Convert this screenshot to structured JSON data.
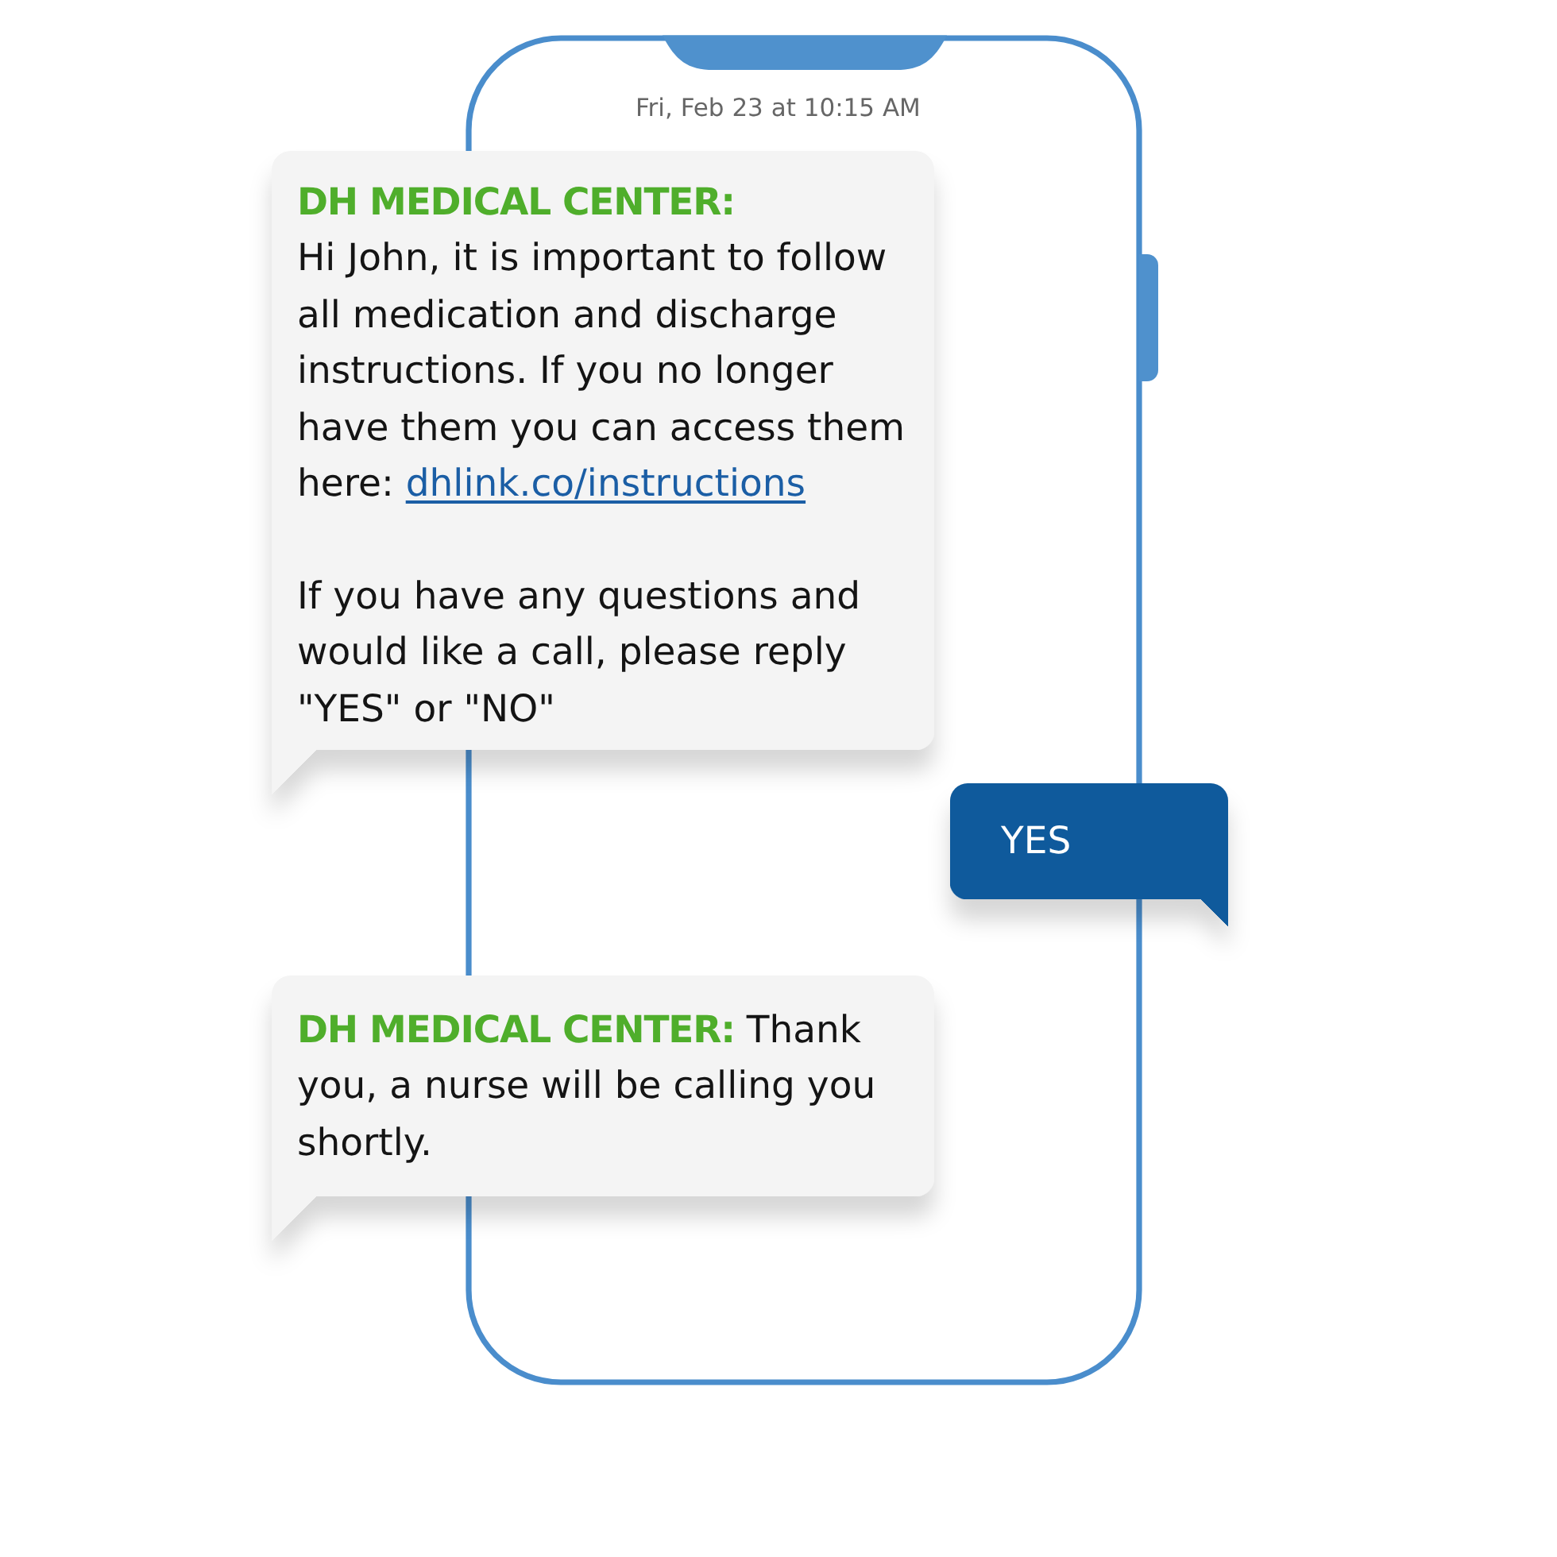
{
  "timestamp": "Fri, Feb 23 at 10:15 AM",
  "messages": [
    {
      "kind": "incoming",
      "sender": "DH MEDICAL CENTER:",
      "sender_on_own_line": true,
      "paragraphs": [
        {
          "text": "Hi John, it is important to follow all medication and discharge instructions. If you no longer have them you can access them here:",
          "link": "dhlink.co/instructions"
        },
        {
          "text": "If you have any questions and would like a call, please reply \"YES\" or \"NO\""
        }
      ]
    },
    {
      "kind": "outgoing",
      "text": "YES"
    },
    {
      "kind": "incoming",
      "sender": "DH MEDICAL CENTER:",
      "sender_on_own_line": false,
      "paragraphs": [
        {
          "text": "Thank you, a nurse will be calling you shortly."
        }
      ]
    }
  ]
}
